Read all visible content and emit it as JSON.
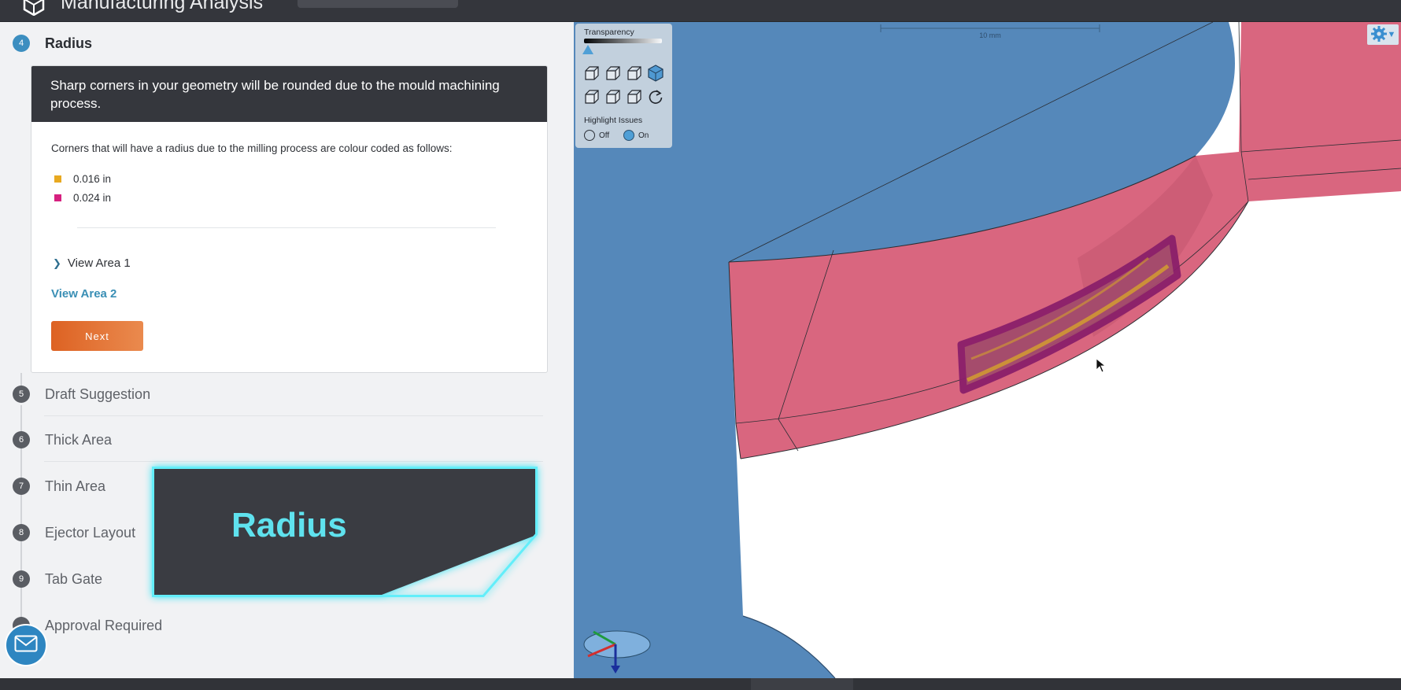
{
  "app": {
    "title": "Manufacturing Analysis"
  },
  "steps": [
    {
      "number": "4",
      "label": "Radius",
      "active": true
    },
    {
      "number": "5",
      "label": "Draft Suggestion"
    },
    {
      "number": "6",
      "label": "Thick Area"
    },
    {
      "number": "7",
      "label": "Thin Area"
    },
    {
      "number": "8",
      "label": "Ejector Layout"
    },
    {
      "number": "9",
      "label": "Tab Gate"
    },
    {
      "number": "",
      "label": "Approval Required"
    }
  ],
  "card": {
    "header": "Sharp corners in your geometry will be rounded due to the mould machining process.",
    "description": "Corners that will have a radius due to the milling process are colour coded as follows:",
    "legend": [
      {
        "label": "0.016 in",
        "color": "#e8a920"
      },
      {
        "label": "0.024 in",
        "color": "#d6207f"
      }
    ],
    "view_area_1": "View Area 1",
    "view_area_2": "View Area 2",
    "next_label": "Next"
  },
  "overlay": {
    "title": "Radius"
  },
  "viewer": {
    "transparency_label": "Transparency",
    "highlight_label": "Highlight Issues",
    "off_label": "Off",
    "on_label": "On",
    "highlight_on": true,
    "scale_label": "10 mm",
    "view_icons": [
      "cube-front-icon",
      "cube-side-icon",
      "cube-top-icon",
      "cube-iso-icon",
      "cube-back-icon",
      "cube-left-icon",
      "cube-bottom-icon",
      "reset-view-icon"
    ],
    "colors": {
      "part_blue": "#5588ba",
      "face_pink": "#d9667f",
      "accent": "#3c8ec0"
    }
  }
}
